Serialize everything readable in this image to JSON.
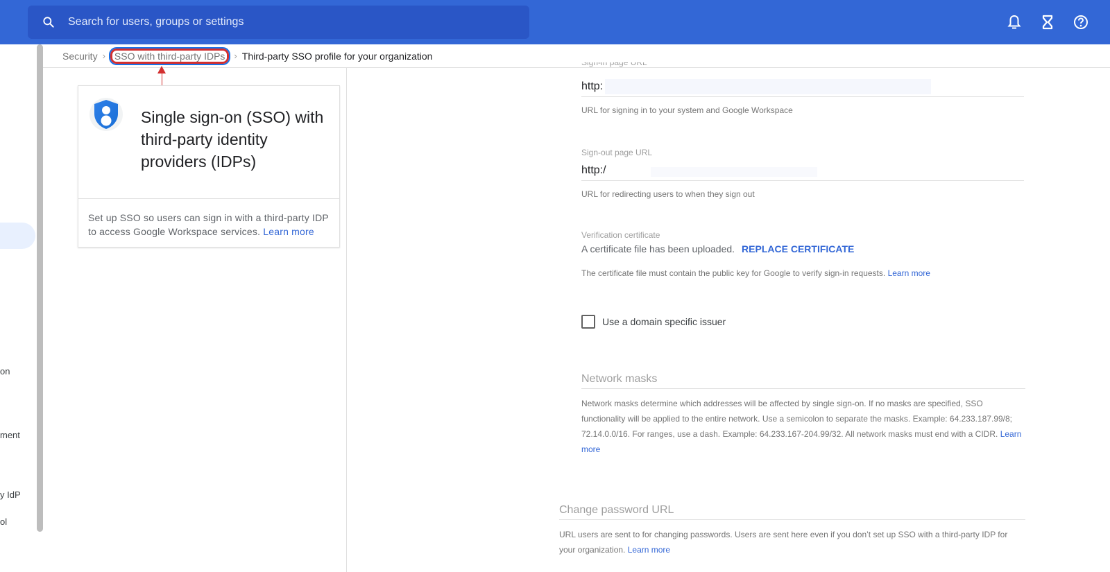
{
  "topbar": {
    "search_placeholder": "Search for users, groups or settings",
    "icons": [
      "search-icon",
      "bell-icon",
      "hourglass-icon",
      "help-icon"
    ]
  },
  "left_nav": {
    "items": [
      {
        "label": "on"
      },
      {
        "label": "ment"
      },
      {
        "label": "y IdP"
      },
      {
        "label": "ol"
      }
    ]
  },
  "breadcrumb": {
    "items": [
      "Security",
      "SSO with third-party IDPs",
      "Third-party SSO profile for your organization"
    ],
    "separator": "›"
  },
  "card": {
    "icon": "shield-user-icon",
    "title": "Single sign-on (SSO) with third-party identity providers (IDPs)",
    "description": "Set up SSO so users can sign in with a third-party IDP to access Google Workspace services.",
    "link": "Learn more"
  },
  "settings": {
    "sign_in": {
      "label": "Sign-in page URL",
      "value": "http:",
      "helper": "URL for signing in to your system and Google Workspace"
    },
    "sign_out": {
      "label": "Sign-out page URL",
      "value": "http:/",
      "helper": "URL for redirecting users to when they sign out"
    },
    "certificate": {
      "label": "Verification certificate",
      "status": "A certificate file has been uploaded.",
      "button": "REPLACE CERTIFICATE",
      "helper": "The certificate file must contain the public key for Google to verify sign-in requests.",
      "link": "Learn more"
    },
    "domain_issuer": {
      "label": "Use a domain specific issuer",
      "checked": false
    },
    "network_masks": {
      "heading": "Network masks",
      "helper": "Network masks determine which addresses will be affected by single sign-on. If no masks are specified, SSO functionality will be applied to the entire network. Use a semicolon to separate the masks. Example: 64.233.187.99/8; 72.14.0.0/16. For ranges, use a dash. Example: 64.233.167-204.99/32. All network masks must end with a CIDR.",
      "link": "Learn more"
    },
    "change_password": {
      "heading": "Change password URL",
      "helper": "URL users are sent to for changing passwords. Users are sent here even if you don’t set up SSO with a third-party IDP for your organization.",
      "link": "Learn more"
    }
  },
  "colors": {
    "topbar": "#3367d6",
    "search_bg": "#2a56c6",
    "link": "#3367d6",
    "annotation": "#d32f2f"
  }
}
